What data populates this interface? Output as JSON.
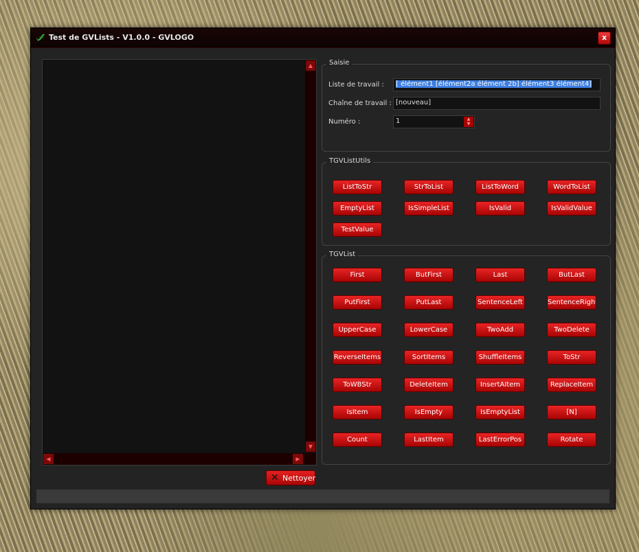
{
  "window": {
    "title": "Test de GVLists - V1.0.0 - GVLOGO",
    "close_label": "x"
  },
  "output": {
    "nettoyer_label": "Nettoyer"
  },
  "saisie": {
    "group_title": "Saisie",
    "liste_label": "Liste de travail :",
    "liste_value": "[ élément1 [élément2a élément 2b] élément3 élément4]",
    "chaine_label": "Chaîne de travail :",
    "chaine_value": "[nouveau]",
    "numero_label": "Numéro :",
    "numero_value": "1"
  },
  "utils": {
    "group_title": "TGVListUtils",
    "buttons": [
      "ListToStr",
      "StrToList",
      "ListToWord",
      "WordToList",
      "EmptyList",
      "IsSimpleList",
      "IsValid",
      "IsValidValue",
      "TestValue"
    ]
  },
  "list": {
    "group_title": "TGVList",
    "buttons": [
      "First",
      "ButFirst",
      "Last",
      "ButLast",
      "PutFirst",
      "PutLast",
      "SentenceLeft",
      "SentenceRight",
      "UpperCase",
      "LowerCase",
      "TwoAdd",
      "TwoDelete",
      "ReverseItems",
      "SortItems",
      "ShuffleItems",
      "ToStr",
      "ToWBStr",
      "DeleteItem",
      "InsertAItem",
      "ReplaceItem",
      "IsItem",
      "IsEmpty",
      "IsEmptyList",
      "[N]",
      "Count",
      "LastItem",
      "LastErrorPos",
      "Rotate"
    ]
  },
  "colors": {
    "accent": "#d81414",
    "window_bg": "#232323"
  },
  "icons": {
    "app": "gecko-icon",
    "close": "close-icon",
    "nettoyer": "clear-x-icon"
  }
}
